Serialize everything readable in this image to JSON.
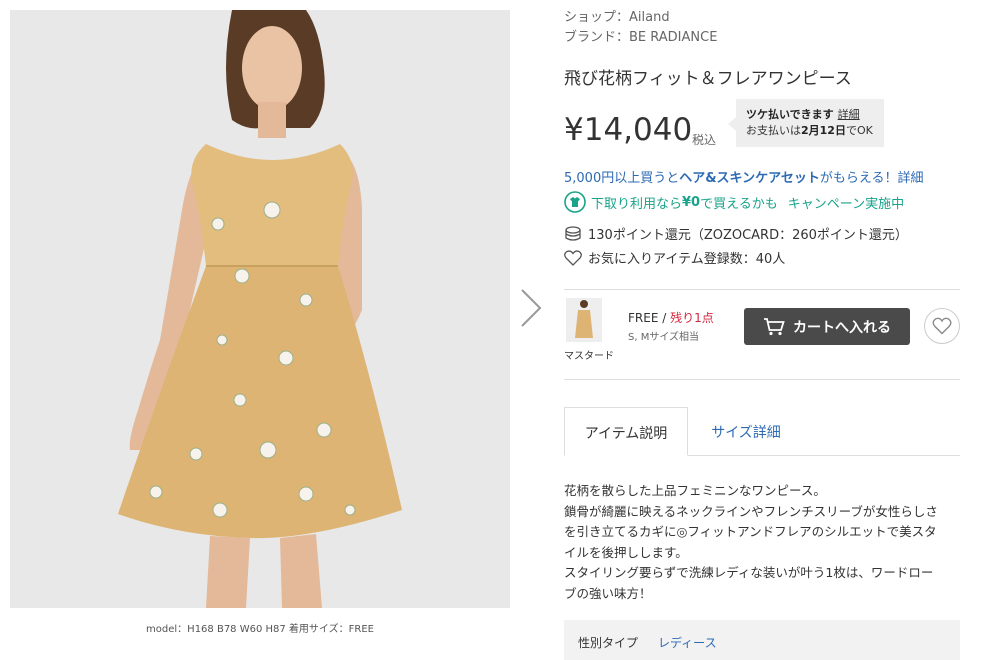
{
  "model_caption": "model：H168 B78 W60 H87 着用サイズ：FREE",
  "shop_line": "ショップ：Ailand",
  "brand_line": "ブランド：BE RADIANCE",
  "product_title": "飛び花柄フィット＆フレアワンピース",
  "price": "¥14,040",
  "tax_label": "税込",
  "tsuke": {
    "title": "ツケ払いできます",
    "detail_link": "詳細",
    "date_line_pre": "お支払いは",
    "date_bold": "2月12日",
    "date_line_post": "でOK"
  },
  "promo_haircare": {
    "pre": "5,000円以上買うと",
    "bold": "ヘア&スキンケアセット",
    "post": "がもらえる！詳細"
  },
  "promo_tradein": {
    "pre": "下取り利用なら",
    "bold": "¥0",
    "post": "で買えるかも",
    "campaign": "キャンペーン実施中"
  },
  "points_text": "130ポイント還元（ZOZOCARD：260ポイント還元）",
  "favorites_text": "お気に入りアイテム登録数：40人",
  "variant": {
    "color_name": "マスタード",
    "size": "FREE",
    "separator": " / ",
    "stock": "残り1点",
    "size_note": "S, Mサイズ相当"
  },
  "cart_button": "カートへ入れる",
  "tabs": [
    {
      "label": "アイテム説明"
    },
    {
      "label": "サイズ詳細"
    }
  ],
  "description": [
    "花柄を散らした上品フェミニンなワンピース。",
    "鎖骨が綺麗に映えるネックラインやフレンチスリーブが女性らしさ",
    "を引き立てるカギに◎フィットアンドフレアのシルエットで美スタ",
    "イルを後押しします。",
    "スタイリング要らずで洗練レディな装いが叶う1枚は、ワードロー",
    "ブの強い味方！"
  ],
  "spec": {
    "label": "性別タイプ",
    "value": "レディース"
  },
  "colors": {
    "link_blue": "#2d6ab4",
    "teal": "#19a38a",
    "stock_red": "#d6263c",
    "cart_bg": "#4a4a4a",
    "dress": "#e2bd7e"
  },
  "icons": [
    "chevron-right-icon",
    "tshirt-cycle-icon",
    "coin-stack-icon",
    "heart-outline-icon",
    "cart-icon",
    "heart-icon"
  ]
}
